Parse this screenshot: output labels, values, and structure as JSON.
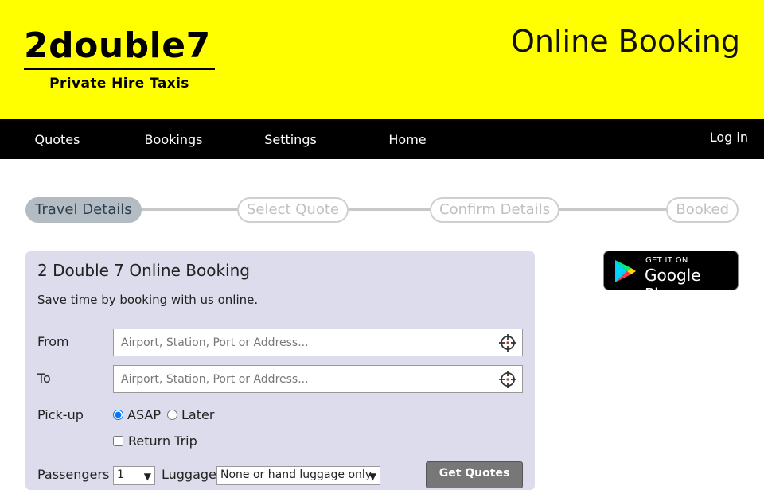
{
  "header": {
    "logo_main": "2double7",
    "logo_sub": "Private Hire Taxis",
    "title": "Online Booking",
    "background": "#ffff00"
  },
  "nav": {
    "items": [
      {
        "label": "Quotes"
      },
      {
        "label": "Bookings"
      },
      {
        "label": "Settings"
      },
      {
        "label": "Home"
      }
    ],
    "login": "Log in"
  },
  "steps": [
    {
      "label": "Travel Details",
      "active": true
    },
    {
      "label": "Select Quote",
      "active": false
    },
    {
      "label": "Confirm Details",
      "active": false
    },
    {
      "label": "Booked",
      "active": false
    }
  ],
  "form": {
    "title": "2 Double 7 Online Booking",
    "subtitle": "Save time by booking with us online.",
    "from_label": "From",
    "to_label": "To",
    "address_placeholder": "Airport, Station, Port or Address...",
    "pickup_label": "Pick-up",
    "pickup_asap": "ASAP",
    "pickup_later": "Later",
    "pickup_selected": "ASAP",
    "return_trip": "Return Trip",
    "passengers_label": "Passengers",
    "passengers_value": "1",
    "luggage_label": "Luggage",
    "luggage_value": "None or hand luggage only",
    "submit": "Get Quotes"
  },
  "store_badge": {
    "get_it_on": "GET IT ON",
    "store": "Google Play",
    "icon": "google-play-icon"
  }
}
